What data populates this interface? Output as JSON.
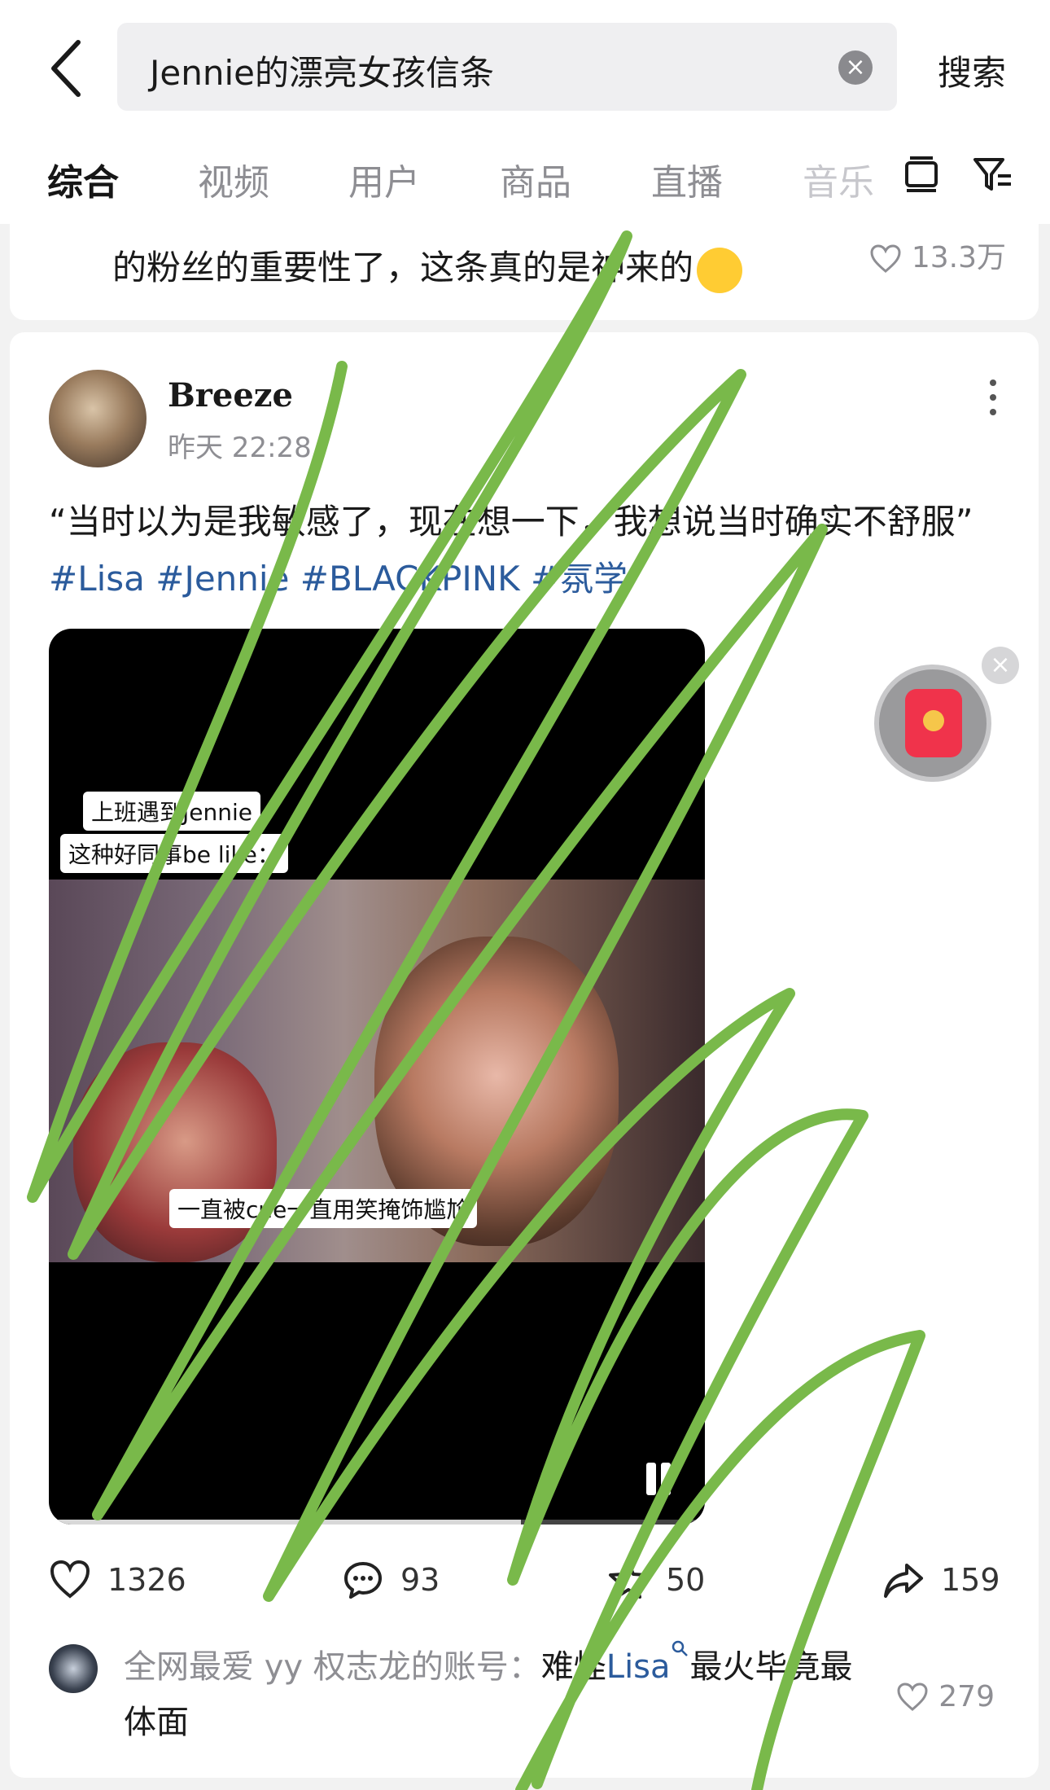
{
  "search": {
    "query": "Jennie的漂亮女孩信条",
    "button_label": "搜索"
  },
  "tabs": [
    "综合",
    "视频",
    "用户",
    "商品",
    "直播",
    "音乐"
  ],
  "previous_post": {
    "text": "的粉丝的重要性了，这条真的是神来的",
    "likes": "13.3万"
  },
  "post": {
    "author": "Breeze",
    "time": "昨天 22:28",
    "body": "“当时以为是我敏感了，现在想一下，我想说当时确实不舒服”",
    "tags": [
      "#Lisa",
      "#Jennie",
      "#BLACKPINK",
      "#氛学"
    ],
    "video": {
      "captions": [
        "上班遇到Jennie",
        "这种好同事be like：",
        "一直被cue一直用笑掩饰尴尬"
      ],
      "progress": 0.72
    },
    "stats": {
      "likes": "1326",
      "comments": "93",
      "favorites": "50",
      "shares": "159"
    }
  },
  "comment": {
    "user": "全网最爱 yy 权志龙的账号：",
    "text_before": "难怪",
    "link": "Lisa",
    "text_after": "最火毕竟最体面",
    "likes": "279"
  },
  "colors": {
    "tag_blue": "#2b5b9c",
    "scribble_green": "#79b94a",
    "red_packet": "#f0334b"
  }
}
